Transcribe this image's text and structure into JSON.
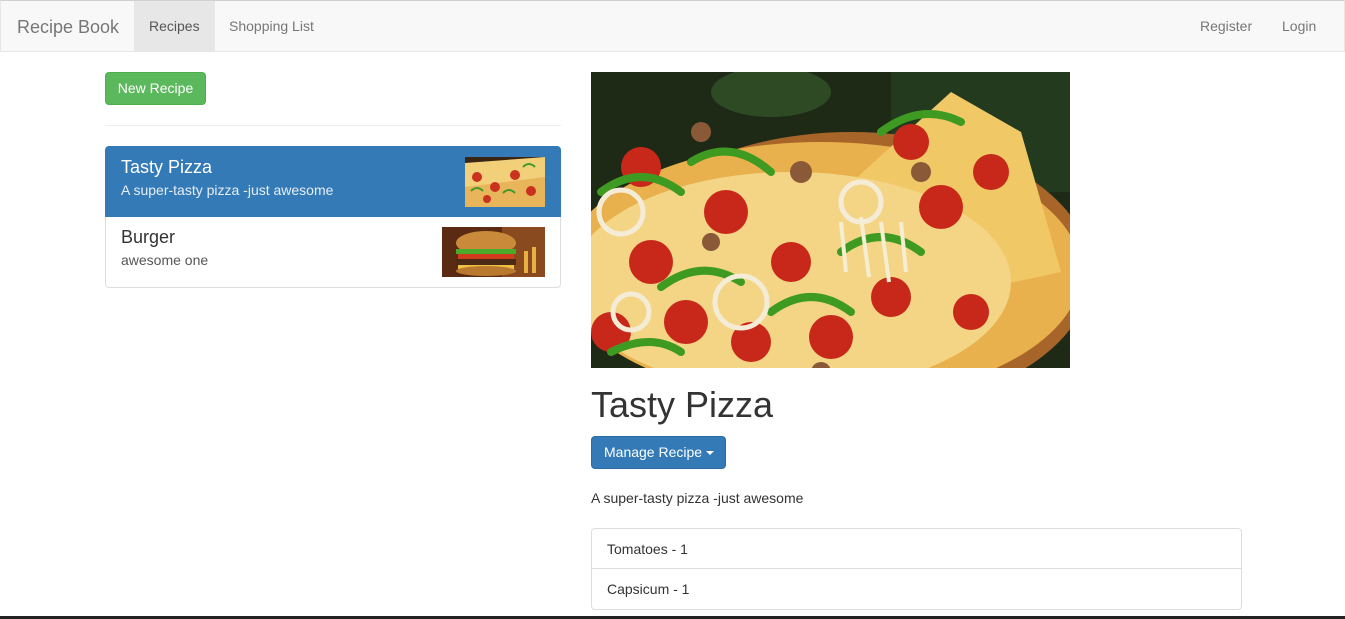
{
  "navbar": {
    "brand": "Recipe Book",
    "links": [
      "Recipes",
      "Shopping List"
    ],
    "right_links": [
      "Register",
      "Login"
    ]
  },
  "sidebar": {
    "new_recipe_label": "New Recipe",
    "recipes": [
      {
        "name": "Tasty Pizza",
        "description": "A super-tasty pizza -just awesome",
        "image": "pizza-thumbnail"
      },
      {
        "name": "Burger",
        "description": "awesome one",
        "image": "burger-thumbnail"
      }
    ]
  },
  "detail": {
    "image": "pizza-photo",
    "name": "Tasty Pizza",
    "manage_label": "Manage Recipe",
    "description": "A super-tasty pizza -just awesome",
    "ingredients": [
      "Tomatoes - 1",
      "Capsicum - 1"
    ]
  },
  "colors": {
    "primary": "#337ab7",
    "success": "#5cb85c",
    "navbar_bg": "#f8f8f8"
  }
}
